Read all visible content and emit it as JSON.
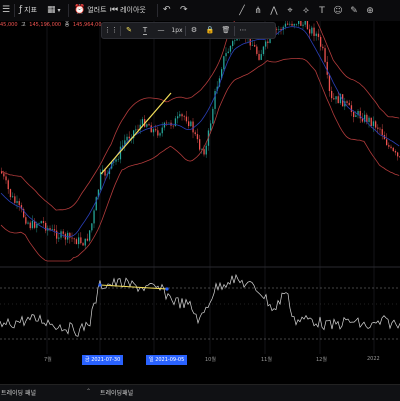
{
  "toolbar": {
    "indicators_label": "지표",
    "alert_label": "얼러트",
    "layout_label": "레이아웃",
    "draw_tools": [
      "line-tool-icon",
      "fork-tool-icon",
      "pattern-tool-icon",
      "crosshair-tool-icon",
      "measure-tool-icon",
      "text-tool-icon",
      "emoji-tool-icon",
      "brush-tool-icon",
      "zoom-tool-icon"
    ]
  },
  "ohlc": {
    "open": "45,000",
    "high": "145,196,000",
    "close_label": "종",
    "close": "145,964,00",
    "prefix": "고"
  },
  "format_bar": {
    "width_label": "1px",
    "color": "#f5e05a"
  },
  "x_axis": {
    "labels": [
      "7월",
      "10월",
      "11월",
      "12월",
      "2022"
    ],
    "highlight_start": "금 2021-07-30",
    "highlight_end": "일 2021-09-05"
  },
  "bottom": {
    "tab1": "트레이딩 패널",
    "tab2": "트레이딩패널"
  },
  "colors": {
    "up": "#26a69a",
    "down": "#ef5350",
    "band": "#b23b3b",
    "mid": "#2a3fb8",
    "trend": "#f5e05a",
    "accent": "#2962ff"
  }
}
